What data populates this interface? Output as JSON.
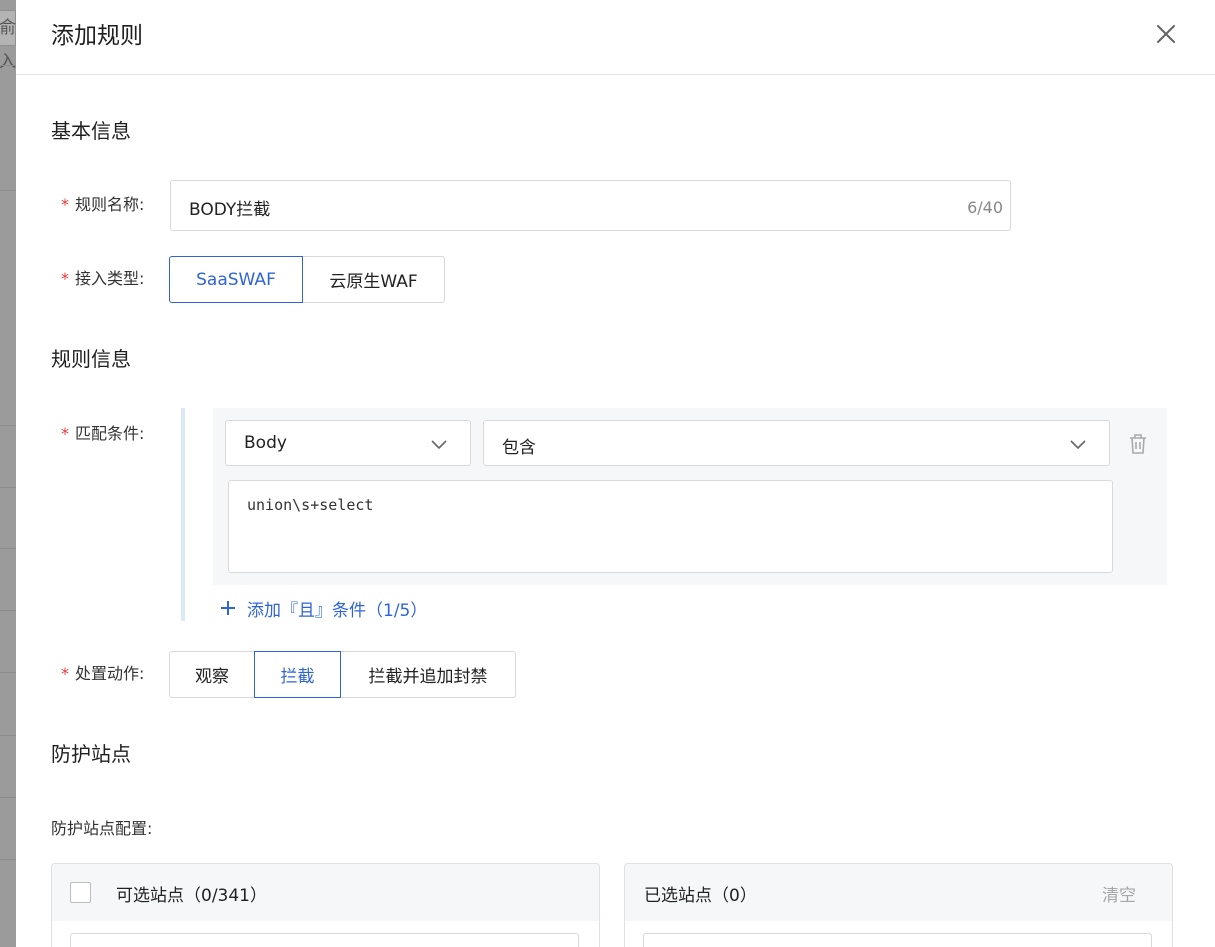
{
  "background": {
    "input_fragment": "俞入"
  },
  "drawer": {
    "title": "添加规则",
    "close_icon": "close-icon"
  },
  "sections": {
    "basic": "基本信息",
    "rule": "规则信息",
    "sites": "防护站点"
  },
  "form": {
    "required_mark": "*",
    "name": {
      "label": "规则名称:",
      "value": "BODY拦截",
      "count": "6/40"
    },
    "access_type": {
      "label": "接入类型:",
      "options": [
        "SaaSWAF",
        "云原生WAF"
      ],
      "selected": "SaaSWAF"
    },
    "match": {
      "label": "匹配条件:",
      "field": "Body",
      "operator": "包含",
      "value": "union\\s+select",
      "add_label": "添加『且』条件（1/5）",
      "delete_icon": "trash-icon"
    },
    "action": {
      "label": "处置动作:",
      "options": [
        "观察",
        "拦截",
        "拦截并追加封禁"
      ],
      "selected": "拦截"
    },
    "site_config_label": "防护站点配置:"
  },
  "transfer": {
    "available_title": "可选站点（0/341）",
    "selected_title": "已选站点（0）",
    "clear_label": "清空"
  },
  "colors": {
    "primary": "#2f64d8",
    "required": "#e23a3a",
    "muted": "#a6a6a6"
  }
}
